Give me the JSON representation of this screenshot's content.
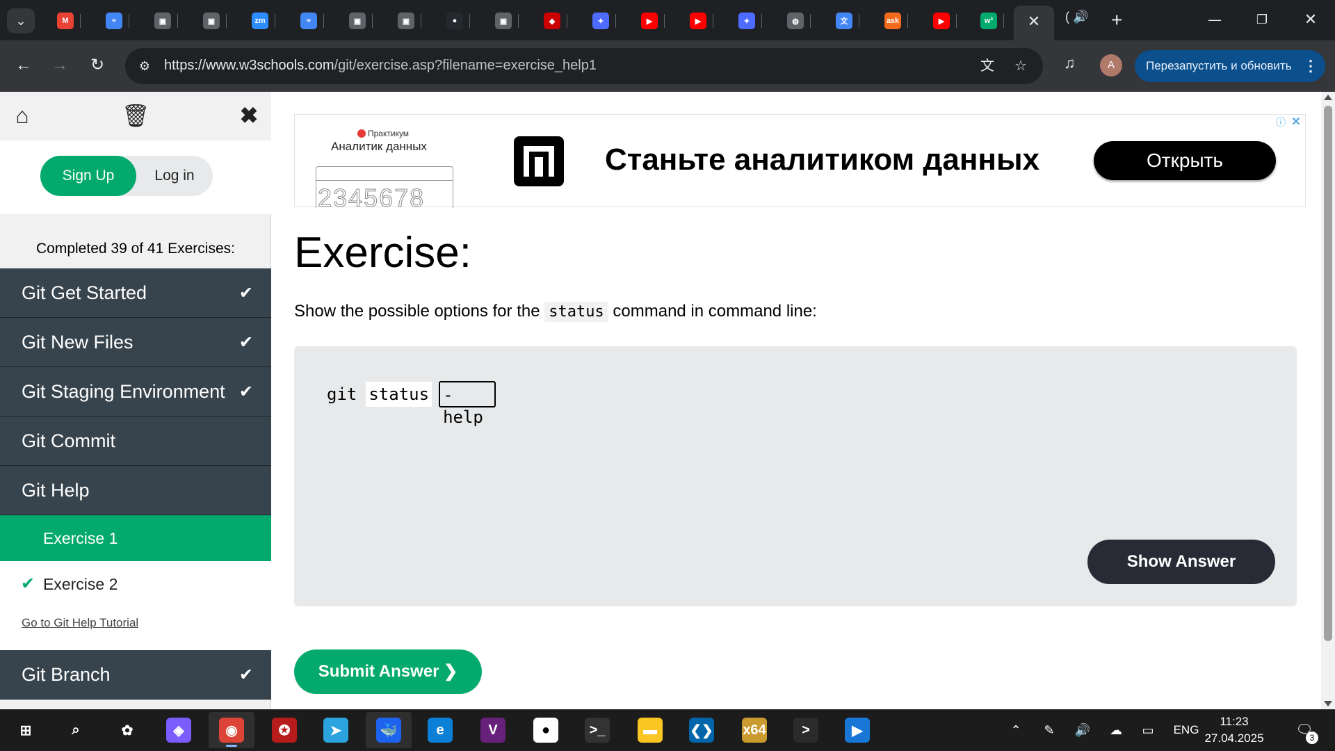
{
  "browser": {
    "tabs": [
      {
        "icon": "gmail-icon",
        "glyph": "M",
        "color": "#ea4335"
      },
      {
        "icon": "docs-icon",
        "glyph": "≡",
        "color": "#4285f4"
      },
      {
        "icon": "generic-page-icon",
        "glyph": "▣",
        "color": "#5f6368"
      },
      {
        "icon": "generic-page-icon",
        "glyph": "▣",
        "color": "#5f6368"
      },
      {
        "icon": "zoom-icon",
        "glyph": "zm",
        "color": "#2d8cff"
      },
      {
        "icon": "docs-icon",
        "glyph": "≡",
        "color": "#4285f4"
      },
      {
        "icon": "generic-page-icon",
        "glyph": "▣",
        "color": "#5f6368"
      },
      {
        "icon": "generic-page-icon",
        "glyph": "▣",
        "color": "#5f6368"
      },
      {
        "icon": "github-icon",
        "glyph": "●",
        "color": "#24292e"
      },
      {
        "icon": "generic-page-icon",
        "glyph": "▣",
        "color": "#5f6368"
      },
      {
        "icon": "redhat-icon",
        "glyph": "◆",
        "color": "#cc0000"
      },
      {
        "icon": "deepseek-icon",
        "glyph": "✦",
        "color": "#4d6bfe"
      },
      {
        "icon": "youtube-icon",
        "glyph": "▶",
        "color": "#ff0000"
      },
      {
        "icon": "youtube-icon",
        "glyph": "▶",
        "color": "#ff0000"
      },
      {
        "icon": "deepseek-icon",
        "glyph": "✦",
        "color": "#4d6bfe"
      },
      {
        "icon": "globe-icon",
        "glyph": "◍",
        "color": "#5f6368"
      },
      {
        "icon": "translate-icon",
        "glyph": "文",
        "color": "#4285f4"
      },
      {
        "icon": "ask-icon",
        "glyph": "ask",
        "color": "#f26b1d"
      },
      {
        "icon": "youtube-icon",
        "glyph": "▶",
        "color": "#ff0000"
      },
      {
        "icon": "w3schools-icon",
        "glyph": "w³",
        "color": "#04aa6d"
      }
    ],
    "active_tab_close": "✕",
    "audio_tab_label": "(",
    "new_tab": "+",
    "url_host": "https://www.w3schools.com",
    "url_path": "/git/exercise.asp?filename=exercise_help1",
    "profile_initial": "A",
    "relaunch_label": "Перезапустить и обновить"
  },
  "sidebar": {
    "signup": "Sign Up",
    "login": "Log in",
    "completed": "Completed 39 of 41 Exercises:",
    "chapters_before": [
      {
        "label": "Git Get Started",
        "done": "✔"
      },
      {
        "label": "Git New Files",
        "done": "✔"
      },
      {
        "label": "Git Staging Environment",
        "done": "✔"
      },
      {
        "label": "Git Commit",
        "done": ""
      },
      {
        "label": "Git Help",
        "done": ""
      }
    ],
    "active_exercise": "Exercise 1",
    "exercise2": "Exercise 2",
    "exercise2_check": "✔",
    "tutorial_link": "Go to Git Help Tutorial",
    "chapter_after": {
      "label": "Git Branch",
      "done": "✔"
    }
  },
  "ad": {
    "brand": "Практикум",
    "subtitle": "Аналитик данных",
    "digits": "2345678",
    "headline": "Станьте аналитиком данных",
    "cta": "Открыть"
  },
  "exercise": {
    "title": "Exercise:",
    "question_before": "Show the possible options for the ",
    "question_code": "status",
    "question_after": " command in command line:",
    "code_git": "git",
    "code_status": "status",
    "answer_value": "-help",
    "show_answer": "Show Answer",
    "submit": "Submit Answer ❯"
  },
  "taskbar": {
    "apps": [
      {
        "name": "start-icon",
        "glyph": "⊞",
        "color": "#1c1c1c"
      },
      {
        "name": "search-icon",
        "glyph": "⌕",
        "color": "#1c1c1c"
      },
      {
        "name": "chatgpt-icon",
        "glyph": "✿",
        "color": "#1c1c1c"
      },
      {
        "name": "copilot-icon",
        "glyph": "◈",
        "color": "#7a5cff"
      },
      {
        "name": "chrome-icon",
        "glyph": "◉",
        "color": "#db4437"
      },
      {
        "name": "antivirus-icon",
        "glyph": "✪",
        "color": "#b71c1c"
      },
      {
        "name": "telegram-icon",
        "glyph": "➤",
        "color": "#2aa3df"
      },
      {
        "name": "docker-icon",
        "glyph": "🐳",
        "color": "#1d63ed"
      },
      {
        "name": "edge-icon",
        "glyph": "e",
        "color": "#0c7fd6"
      },
      {
        "name": "visual-studio-installer-icon",
        "glyph": "V",
        "color": "#68217a"
      },
      {
        "name": "penguin-icon",
        "glyph": "●",
        "color": "#ffffff"
      },
      {
        "name": "terminal-icon",
        "glyph": ">_",
        "color": "#333333"
      },
      {
        "name": "file-explorer-icon",
        "glyph": "▬",
        "color": "#f9c623"
      },
      {
        "name": "vscode-icon",
        "glyph": "❮❯",
        "color": "#0065a9"
      },
      {
        "name": "x64dbg-icon",
        "glyph": "x64",
        "color": "#c99a2e"
      },
      {
        "name": "cmd-icon",
        "glyph": ">",
        "color": "#2b2b2b"
      },
      {
        "name": "media-player-icon",
        "glyph": "▶",
        "color": "#1877d6"
      }
    ],
    "lang": "ENG",
    "time": "11:23",
    "date": "27.04.2025",
    "notifications": "3"
  }
}
